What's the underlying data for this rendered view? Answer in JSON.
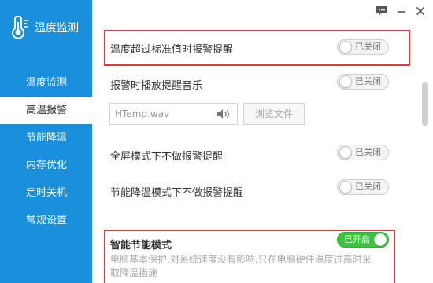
{
  "app": {
    "title": "温度监测"
  },
  "sidebar": {
    "items": [
      {
        "label": "温度监测",
        "active": false
      },
      {
        "label": "高温报警",
        "active": true
      },
      {
        "label": "节能降温",
        "active": false
      },
      {
        "label": "内存优化",
        "active": false
      },
      {
        "label": "定时关机",
        "active": false
      },
      {
        "label": "常规设置",
        "active": false
      }
    ]
  },
  "window_controls": {
    "icons": [
      "feedback-icon",
      "minimize-icon",
      "close-icon"
    ]
  },
  "settings": {
    "over_limit_alert": {
      "label": "温度超过标准值时报警提醒",
      "state": "已关闭",
      "on": false
    },
    "play_music": {
      "label": "报警时播放提醒音乐",
      "state": "已关闭",
      "on": false
    },
    "sound_file": {
      "value": "HTemp.wav",
      "browse_label": "浏览文件"
    },
    "fullscreen_no_alert": {
      "label": "全屏模式下不做报警提醒",
      "state": "已关闭",
      "on": false
    },
    "eco_no_alert": {
      "label": "节能降温模式下不做报警提醒",
      "state": "已关闭",
      "on": false
    },
    "smart_eco": {
      "label": "智能节能模式",
      "state": "已开启",
      "on": true,
      "description": "电脑基本保护,对系统速度没有影响,只在电脑硬件温度过高时采取降温措施"
    }
  },
  "colors": {
    "sidebar_bg": "#1a8fdc",
    "highlight": "#e03a3a",
    "toggle_on": "#3cc23c"
  }
}
